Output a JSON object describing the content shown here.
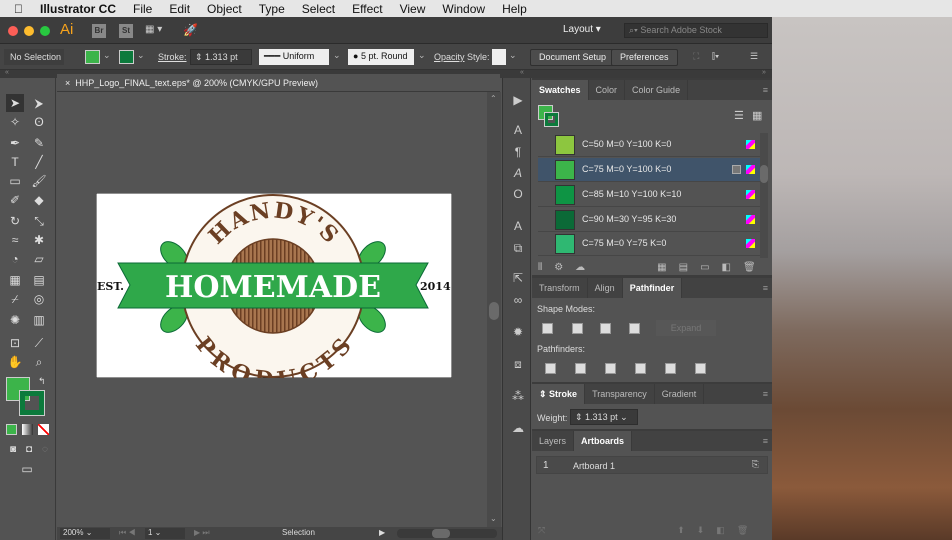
{
  "menubar": {
    "app": "Illustrator CC",
    "items": [
      "File",
      "Edit",
      "Object",
      "Type",
      "Select",
      "Effect",
      "View",
      "Window",
      "Help"
    ]
  },
  "appbar": {
    "logo": "Ai",
    "bridge": "Br",
    "stock": "St",
    "workspace": "Layout",
    "search_placeholder": "Search Adobe Stock"
  },
  "control": {
    "selection": "No Selection",
    "stroke_label": "Stroke:",
    "stroke_value": "1.313 pt",
    "profile": "Uniform",
    "brush": "5 pt. Round",
    "opacity_label": "Opacity",
    "style_label": "Style:",
    "doc_setup": "Document Setup",
    "preferences": "Preferences"
  },
  "document": {
    "tab_title": "HHP_Logo_FINAL_text.eps* @ 200% (CMYK/GPU Preview)",
    "close": "×"
  },
  "artwork": {
    "top": "HANDY'S",
    "banner": "HOMEMADE",
    "bottom": "PRODUCTS",
    "left": "EST.",
    "right": "2014"
  },
  "colors": {
    "fill": "#3cb44a",
    "stroke": "#0c7a3c",
    "banner": "#2fa84a",
    "brown": "#6b3f23"
  },
  "swatches": {
    "tabs": [
      "Swatches",
      "Color",
      "Color Guide"
    ],
    "items": [
      {
        "label": "C=50 M=0 Y=100 K=0",
        "color": "#8dc63f"
      },
      {
        "label": "C=75 M=0 Y=100 K=0",
        "color": "#3cb44a",
        "selected": true
      },
      {
        "label": "C=85 M=10 Y=100 K=10",
        "color": "#0e9444"
      },
      {
        "label": "C=90 M=30 Y=95 K=30",
        "color": "#0b6a37"
      },
      {
        "label": "C=75 M=0 Y=75 K=0",
        "color": "#2fb872"
      }
    ]
  },
  "pathfinder": {
    "tabs": [
      "Transform",
      "Align",
      "Pathfinder"
    ],
    "shape_modes": "Shape Modes:",
    "expand": "Expand",
    "pathfinders": "Pathfinders:"
  },
  "stroke_panel": {
    "tabs": [
      "Stroke",
      "Transparency",
      "Gradient"
    ],
    "weight_label": "Weight:",
    "weight": "1.313 pt"
  },
  "artboards": {
    "tabs": [
      "Layers",
      "Artboards"
    ],
    "rows": [
      {
        "num": "1",
        "name": "Artboard 1"
      }
    ]
  },
  "status": {
    "zoom": "200%",
    "page": "1",
    "tool": "Selection"
  }
}
